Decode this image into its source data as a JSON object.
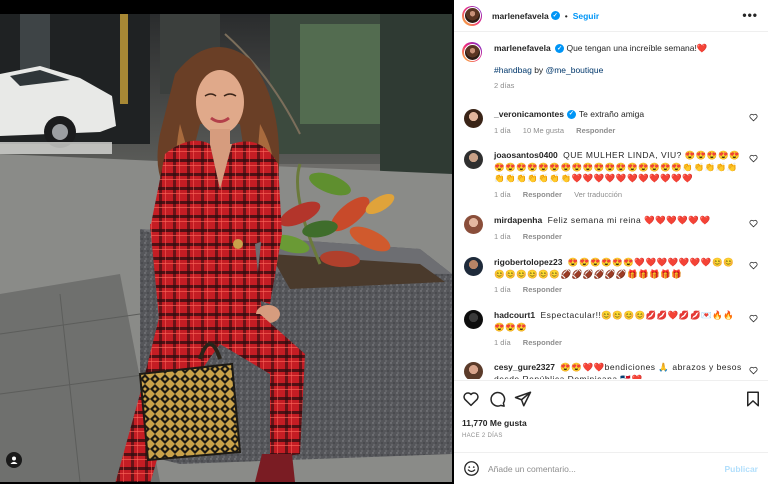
{
  "post": {
    "username": "marlenefavela",
    "follow_label": "Seguir",
    "separator": "•",
    "more_label": "•••",
    "verified_mark": "✓"
  },
  "caption": {
    "username": "marlenefavela",
    "text": "Que tengan una increíble semana!❤️",
    "hashtag": "#handbag",
    "by_text": "by",
    "mention": "@me_boutique",
    "time": "2 días"
  },
  "comments": [
    {
      "username": "_veronicamontes",
      "verified": true,
      "text": "Te extraño amiga",
      "time": "1 día",
      "likes": "10 Me gusta",
      "reply": "Responder",
      "translate": ""
    },
    {
      "username": "joaosantos0400",
      "verified": false,
      "text": "QUE MULHER LINDA, VIU? 😍😍😍😍😍😍😍😍😍😍😍😍😍😍😍😍😍😍😍😍😍😍👏👏👏👏👏👏👏👏👏👏👏👏❤️❤️❤️❤️❤️❤️❤️❤️❤️❤️❤️",
      "time": "1 día",
      "likes": "",
      "reply": "Responder",
      "translate": "Ver traducción"
    },
    {
      "username": "mirdapenha",
      "verified": false,
      "text": "Feliz semana mi reina ❤️❤️❤️❤️❤️❤️",
      "time": "1 día",
      "likes": "",
      "reply": "Responder",
      "translate": ""
    },
    {
      "username": "rigobertolopez23",
      "verified": false,
      "text": "😍😍😍😍😍😍❤️❤️❤️❤️❤️❤️❤️😊😊😊😊😊😊😊😊🏈🏈🏈🏈🏈🏈🎁🎁🎁🎁🎁",
      "time": "1 día",
      "likes": "",
      "reply": "Responder",
      "translate": ""
    },
    {
      "username": "hadcourt1",
      "verified": false,
      "text": "Espectacular!!😊😊😊😊💋💋❤️💋💋💌🔥🔥😍😍😍",
      "time": "1 día",
      "likes": "",
      "reply": "Responder",
      "translate": ""
    },
    {
      "username": "cesy_gure2327",
      "verified": false,
      "text": "😍😍❤️❤️bendiciones 🙏 abrazos y besos desde República Dominicana 🇩🇴❤️",
      "time": "",
      "likes": "",
      "reply": "",
      "translate": ""
    }
  ],
  "actions": {
    "likes": "11,770 Me gusta",
    "date": "HACE 2 DÍAS"
  },
  "add_comment": {
    "placeholder": "Añade un comentario...",
    "publish": "Publicar"
  },
  "colors": {
    "accent": "#0095f6",
    "heart": "#ed4956",
    "muted": "#8e8e8e"
  },
  "icons": [
    "more-options-icon",
    "verified-icon",
    "heart-icon",
    "comment-icon",
    "share-icon",
    "save-icon",
    "emoji-icon",
    "user-tag-icon"
  ]
}
